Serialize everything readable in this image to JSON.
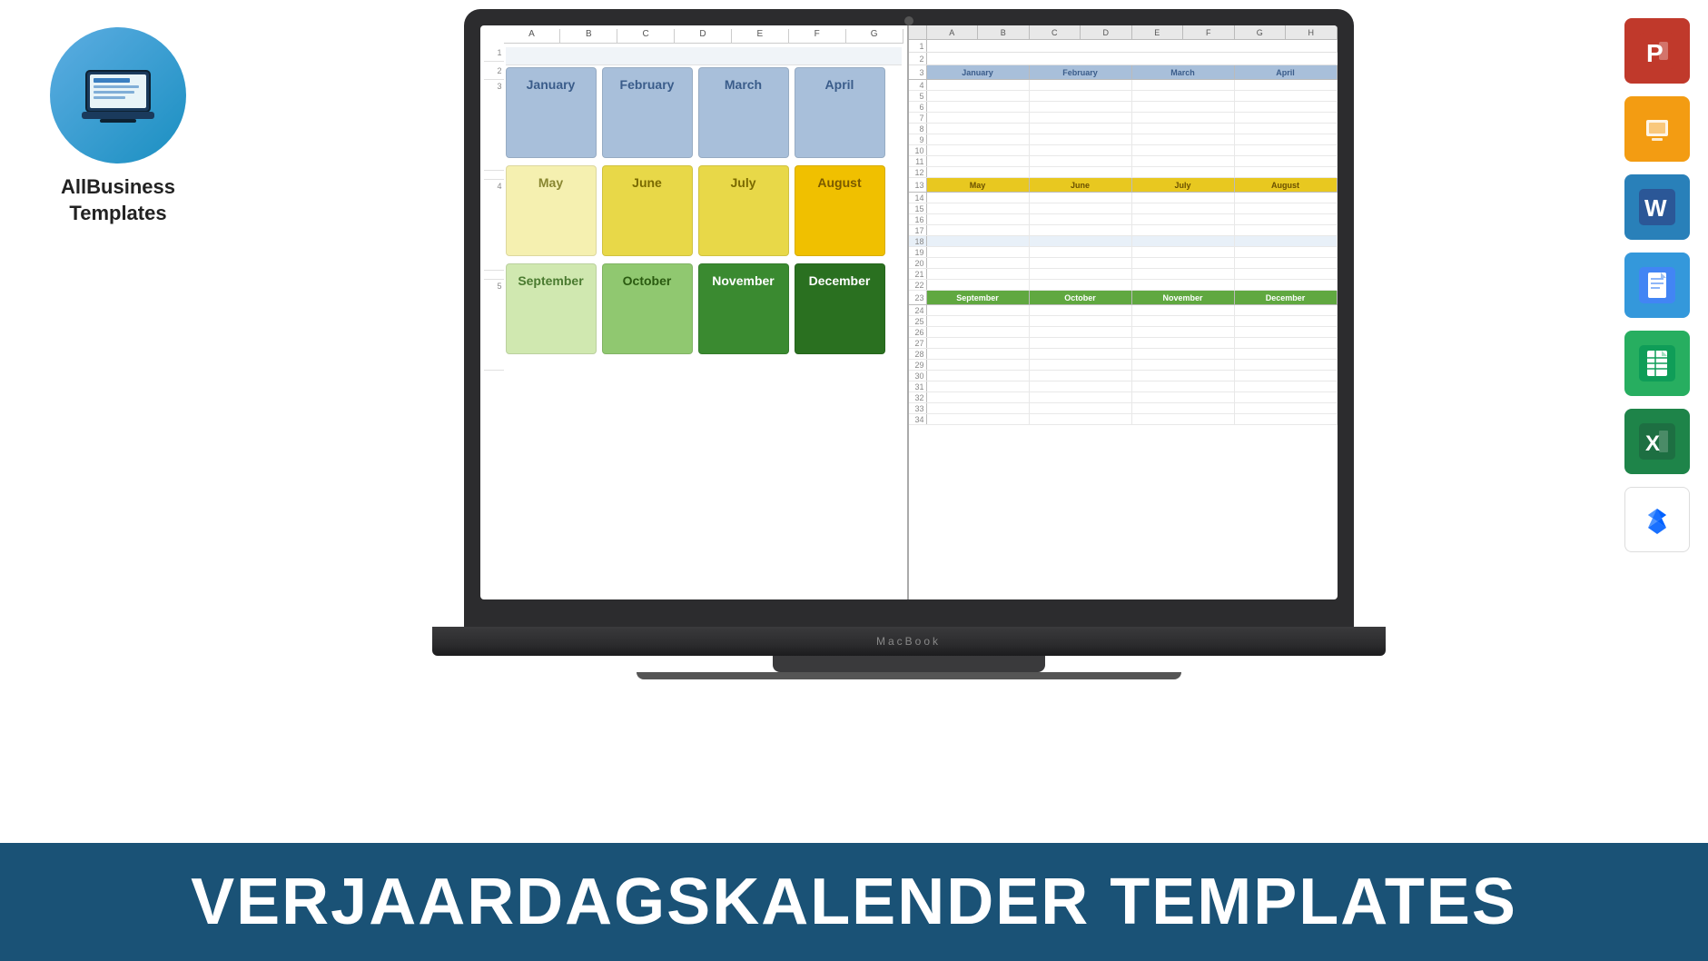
{
  "logo": {
    "company": "AllBusiness",
    "templates": "Templates"
  },
  "banner": {
    "text": "VERJAARDAGSKALENDER TEMPLATES"
  },
  "macbook_label": "MacBook",
  "left_sheet": {
    "col_headers": [
      "A",
      "B",
      "C",
      "D",
      "E",
      "F",
      "G"
    ],
    "months_row1": [
      "January",
      "February",
      "March",
      "April"
    ],
    "months_row2": [
      "May",
      "June",
      "July",
      "August"
    ],
    "months_row3": [
      "September",
      "October",
      "November",
      "December"
    ]
  },
  "right_sheet": {
    "col_headers": [
      "A",
      "B",
      "C",
      "D",
      "E",
      "F",
      "G",
      "H"
    ],
    "months_blue": [
      "January",
      "February",
      "March",
      "April"
    ],
    "months_yellow": [
      "May",
      "June",
      "July",
      "August"
    ],
    "months_green": [
      "September",
      "October",
      "November",
      "December"
    ],
    "row_numbers": [
      1,
      2,
      3,
      4,
      5,
      6,
      7,
      8,
      9,
      10,
      11,
      12,
      13,
      14,
      15,
      16,
      17,
      18,
      19,
      20,
      21,
      22,
      23,
      24,
      25,
      26,
      27,
      28,
      29,
      30,
      31,
      32,
      33,
      34
    ]
  },
  "app_icons": {
    "powerpoint": "P",
    "slides": "G",
    "word": "W",
    "docs": "G",
    "sheets": "S",
    "excel": "X",
    "dropbox": "💧"
  }
}
